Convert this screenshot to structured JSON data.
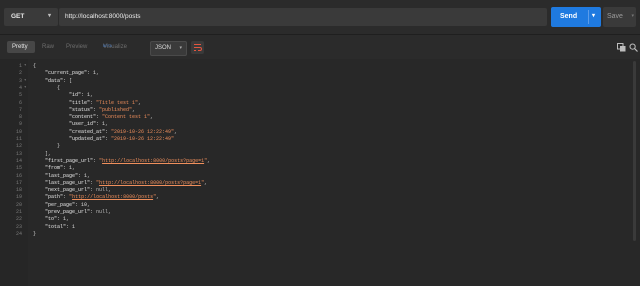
{
  "request": {
    "method": "GET",
    "url": "http://localhost:8000/posts",
    "send_label": "Send",
    "save_label": "Save"
  },
  "response": {
    "tabs": [
      "Pretty",
      "Raw",
      "Preview",
      "Visualize"
    ],
    "beta_badge": "BETA",
    "active_tab": "Pretty",
    "format": "JSON"
  },
  "icons": {
    "method_dropdown": "caret-down",
    "send_dropdown": "caret-down",
    "save_dropdown": "caret-down",
    "format_dropdown": "caret-down",
    "wrap": "wrap-lines",
    "copy": "copy",
    "search": "search"
  },
  "colors": {
    "send": "#1f7ae0",
    "string": "#f08f5c",
    "background": "#282828"
  },
  "code_lines": [
    [
      [
        "p",
        "{"
      ]
    ],
    [
      [
        "p",
        "    "
      ],
      [
        "k",
        "\"current_page\""
      ],
      [
        "p",
        ": "
      ],
      [
        "n",
        "1"
      ],
      [
        "p",
        ","
      ]
    ],
    [
      [
        "p",
        "    "
      ],
      [
        "k",
        "\"data\""
      ],
      [
        "p",
        ": ["
      ]
    ],
    [
      [
        "p",
        "        {"
      ]
    ],
    [
      [
        "p",
        "            "
      ],
      [
        "k",
        "\"id\""
      ],
      [
        "p",
        ": "
      ],
      [
        "n",
        "1"
      ],
      [
        "p",
        ","
      ]
    ],
    [
      [
        "p",
        "            "
      ],
      [
        "k",
        "\"title\""
      ],
      [
        "p",
        ": "
      ],
      [
        "s",
        "\"Title test 1\""
      ],
      [
        "p",
        ","
      ]
    ],
    [
      [
        "p",
        "            "
      ],
      [
        "k",
        "\"status\""
      ],
      [
        "p",
        ": "
      ],
      [
        "s",
        "\"published\""
      ],
      [
        "p",
        ","
      ]
    ],
    [
      [
        "p",
        "            "
      ],
      [
        "k",
        "\"content\""
      ],
      [
        "p",
        ": "
      ],
      [
        "s",
        "\"Content test 1\""
      ],
      [
        "p",
        ","
      ]
    ],
    [
      [
        "p",
        "            "
      ],
      [
        "k",
        "\"user_id\""
      ],
      [
        "p",
        ": "
      ],
      [
        "n",
        "1"
      ],
      [
        "p",
        ","
      ]
    ],
    [
      [
        "p",
        "            "
      ],
      [
        "k",
        "\"created_at\""
      ],
      [
        "p",
        ": "
      ],
      [
        "s",
        "\"2019-10-26 12:22:49\""
      ],
      [
        "p",
        ","
      ]
    ],
    [
      [
        "p",
        "            "
      ],
      [
        "k",
        "\"updated_at\""
      ],
      [
        "p",
        ": "
      ],
      [
        "s",
        "\"2019-10-26 12:22:49\""
      ]
    ],
    [
      [
        "p",
        "        }"
      ]
    ],
    [
      [
        "p",
        "    ],"
      ]
    ],
    [
      [
        "p",
        "    "
      ],
      [
        "k",
        "\"first_page_url\""
      ],
      [
        "p",
        ": "
      ],
      [
        "s",
        "\""
      ],
      [
        "u",
        "http://localhost:8000/posts?page=1"
      ],
      [
        "s",
        "\""
      ],
      [
        "p",
        ","
      ]
    ],
    [
      [
        "p",
        "    "
      ],
      [
        "k",
        "\"from\""
      ],
      [
        "p",
        ": "
      ],
      [
        "n",
        "1"
      ],
      [
        "p",
        ","
      ]
    ],
    [
      [
        "p",
        "    "
      ],
      [
        "k",
        "\"last_page\""
      ],
      [
        "p",
        ": "
      ],
      [
        "n",
        "1"
      ],
      [
        "p",
        ","
      ]
    ],
    [
      [
        "p",
        "    "
      ],
      [
        "k",
        "\"last_page_url\""
      ],
      [
        "p",
        ": "
      ],
      [
        "s",
        "\""
      ],
      [
        "u",
        "http://localhost:8000/posts?page=1"
      ],
      [
        "s",
        "\""
      ],
      [
        "p",
        ","
      ]
    ],
    [
      [
        "p",
        "    "
      ],
      [
        "k",
        "\"next_page_url\""
      ],
      [
        "p",
        ": "
      ],
      [
        "nul",
        "null"
      ],
      [
        "p",
        ","
      ]
    ],
    [
      [
        "p",
        "    "
      ],
      [
        "k",
        "\"path\""
      ],
      [
        "p",
        ": "
      ],
      [
        "s",
        "\""
      ],
      [
        "u",
        "http://localhost:8000/posts"
      ],
      [
        "s",
        "\""
      ],
      [
        "p",
        ","
      ]
    ],
    [
      [
        "p",
        "    "
      ],
      [
        "k",
        "\"per_page\""
      ],
      [
        "p",
        ": "
      ],
      [
        "n",
        "10"
      ],
      [
        "p",
        ","
      ]
    ],
    [
      [
        "p",
        "    "
      ],
      [
        "k",
        "\"prev_page_url\""
      ],
      [
        "p",
        ": "
      ],
      [
        "nul",
        "null"
      ],
      [
        "p",
        ","
      ]
    ],
    [
      [
        "p",
        "    "
      ],
      [
        "k",
        "\"to\""
      ],
      [
        "p",
        ": "
      ],
      [
        "n",
        "1"
      ],
      [
        "p",
        ","
      ]
    ],
    [
      [
        "p",
        "    "
      ],
      [
        "k",
        "\"total\""
      ],
      [
        "p",
        ": "
      ],
      [
        "n",
        "1"
      ]
    ],
    [
      [
        "p",
        "}"
      ]
    ]
  ]
}
